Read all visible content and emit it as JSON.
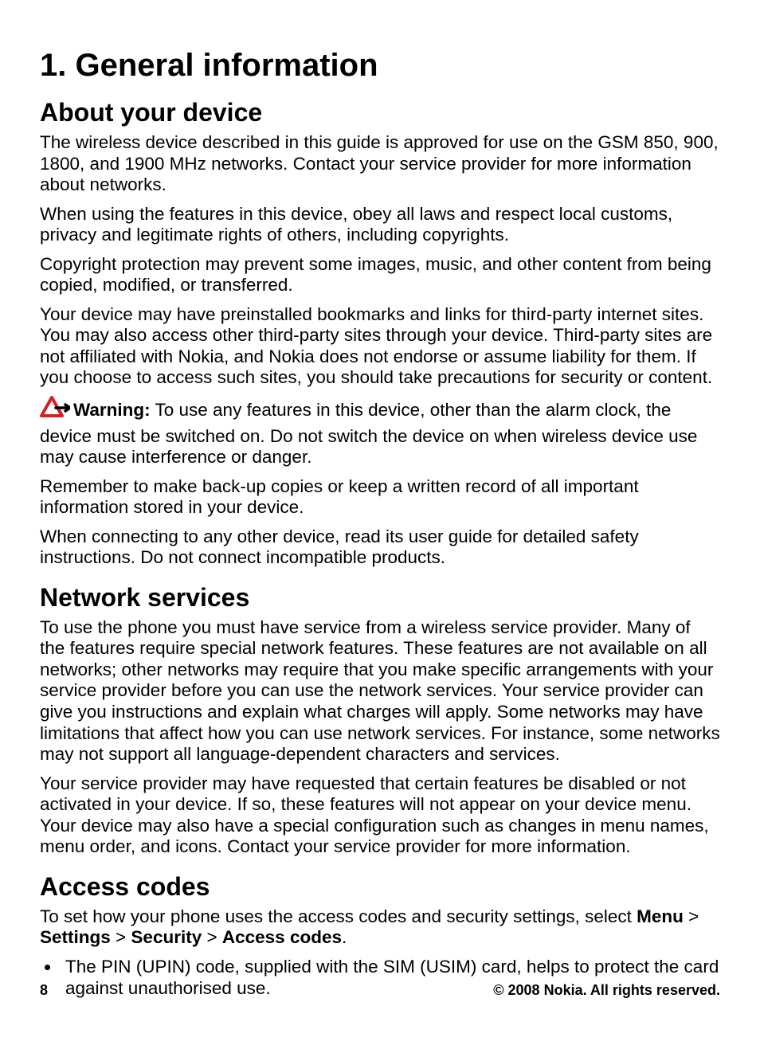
{
  "h1": "1.   General information",
  "sections": {
    "about": {
      "title": "About your device",
      "p1": "The wireless device described in this guide is approved for use on the GSM 850, 900, 1800, and 1900 MHz networks. Contact your service provider for more information about networks.",
      "p2": "When using the features in this device, obey all laws and respect local customs, privacy and legitimate rights of others, including copyrights.",
      "p3": "Copyright protection may prevent some images, music, and other content from being copied, modified, or transferred.",
      "p4": "Your device may have preinstalled bookmarks and links for third-party internet sites. You may also access other third-party sites through your device. Third-party sites are not affiliated with Nokia, and Nokia does not endorse or assume liability for them. If you choose to access such sites, you should take precautions for security or content.",
      "warning_label": "Warning:",
      "warning_text": " To use any features in this device, other than the alarm clock, the device must be switched on. Do not switch the device on when wireless device use may cause interference or danger.",
      "p6": "Remember to make back-up copies or keep a written record of all important information stored in your device.",
      "p7": "When connecting to any other device, read its user guide for detailed safety instructions. Do not connect incompatible products."
    },
    "network": {
      "title": "Network services",
      "p1": "To use the phone you must have service from a wireless service provider. Many of the features require special network features. These features are not available on all networks; other networks may require that you make specific arrangements with your service provider before you can use the network services. Your service provider can give you instructions and explain what charges will apply. Some networks may have limitations that affect how you can use network services. For instance, some networks may not support all language-dependent characters and services.",
      "p2": "Your service provider may have requested that certain features be disabled or not activated in your device. If so, these features will not appear on your device menu. Your device may also have a special configuration such as changes in menu names, menu order, and icons. Contact your service provider for more information."
    },
    "access": {
      "title": "Access codes",
      "intro_pre": "To set how your phone uses the access codes and security settings, select ",
      "menu": "Menu",
      "gt": "  >  ",
      "settings": "Settings",
      "security": "Security",
      "access_codes": "Access codes",
      "period": ".",
      "bullet1": "The PIN (UPIN) code, supplied with the SIM (USIM) card, helps to protect the card against unauthorised use."
    }
  },
  "footer": {
    "page": "8",
    "copyright": "© 2008 Nokia. All rights reserved."
  }
}
